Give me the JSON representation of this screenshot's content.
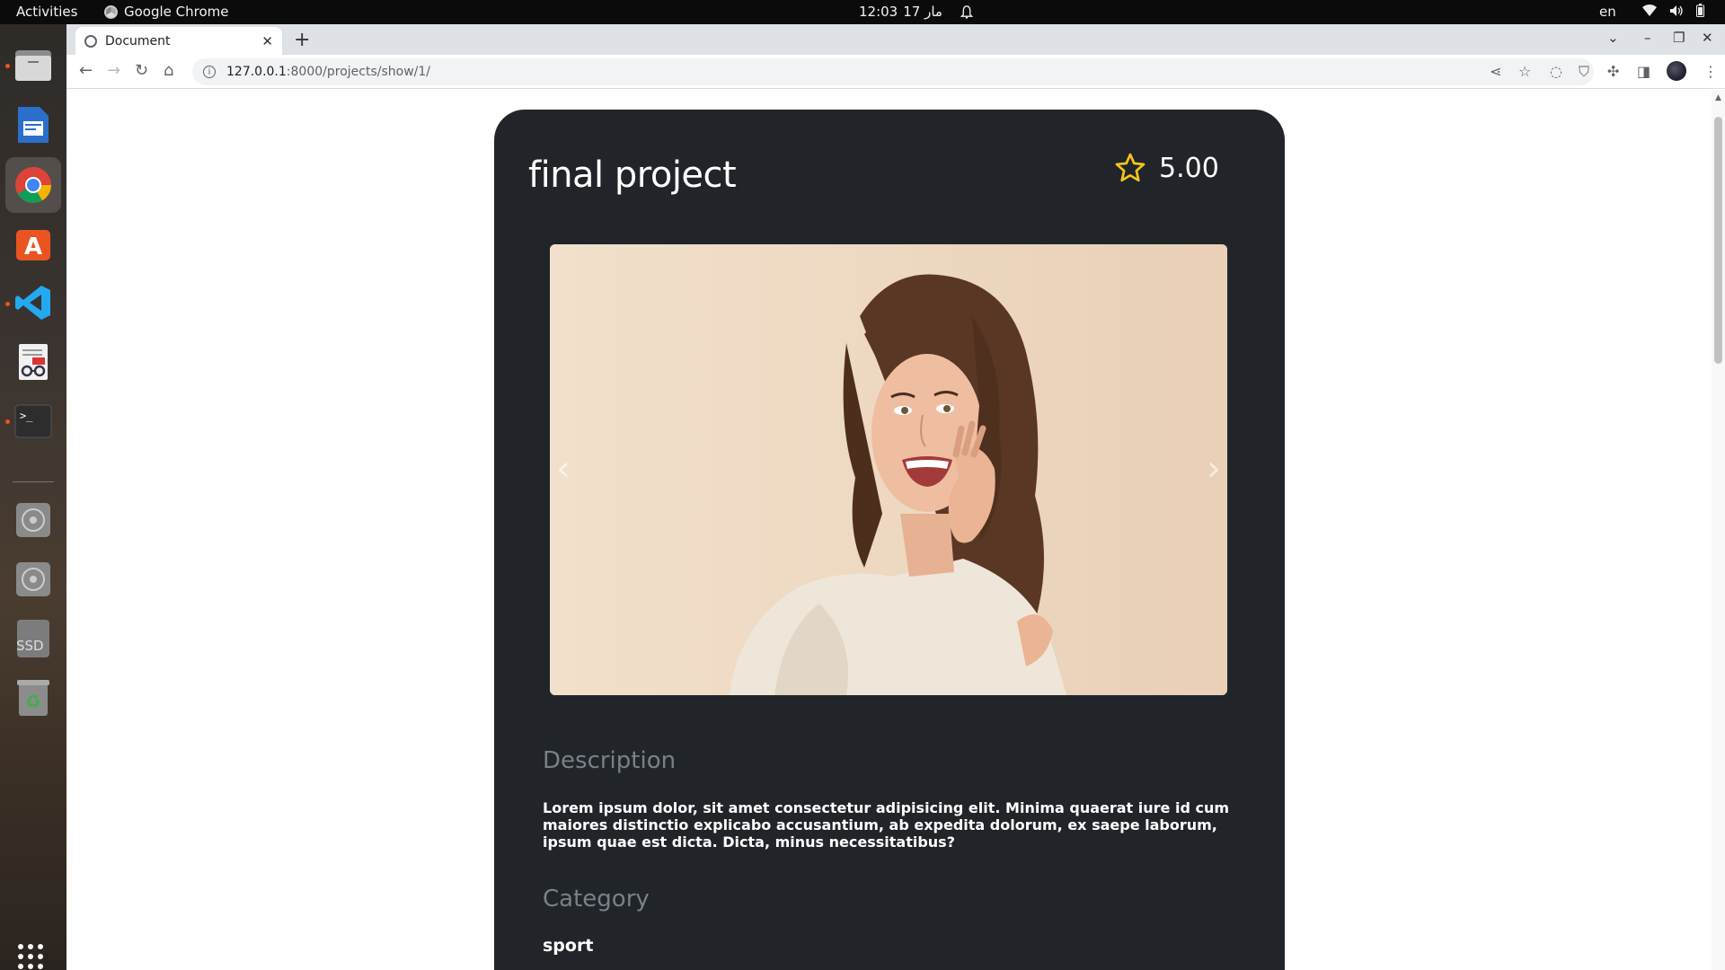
{
  "topbar": {
    "activities": "Activities",
    "app_name": "Google Chrome",
    "time": "12:03",
    "date": "مار 17",
    "language": "en"
  },
  "dock": {
    "items": [
      "files",
      "libreoffice-writer",
      "google-chrome",
      "ubuntu-software",
      "vscode",
      "document-viewer",
      "terminal",
      "disc-1",
      "disc-2",
      "ssd-drive",
      "trash"
    ],
    "ssd_label": "SSD"
  },
  "browser": {
    "tab_title": "Document",
    "url_host": "127.0.0.1",
    "url_path": ":8000/projects/show/1/"
  },
  "project": {
    "title": "final project",
    "rating": "5.00",
    "description_heading": "Description",
    "description": "Lorem ipsum dolor, sit amet consectetur adipisicing elit. Minima quaerat iure id cum maiores distinctio explicabo accusantium, ab expedita dolorum, ex saepe laborum, ipsum quae est dicta. Dicta, minus necessitatibus?",
    "category_heading": "Category",
    "category": "sport"
  },
  "colors": {
    "card_bg": "#212529",
    "star": "#f5c518",
    "heading_muted": "#7a8087",
    "accent": "#e95420"
  }
}
